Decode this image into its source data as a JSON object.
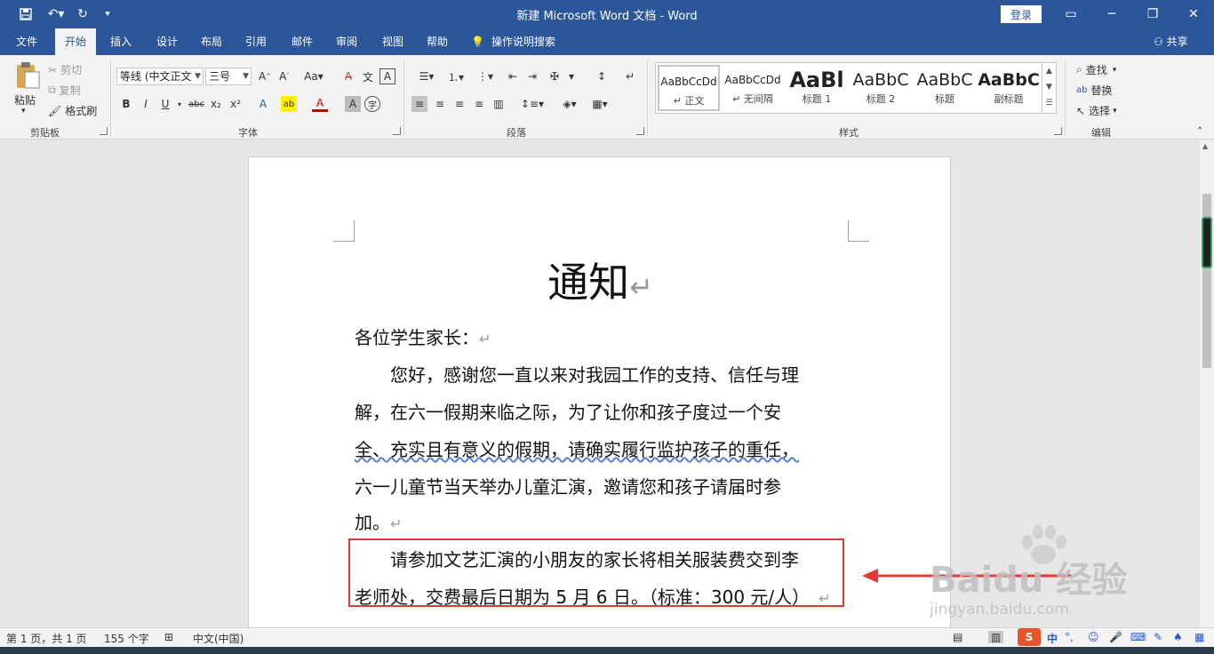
{
  "titlebar": {
    "title": "新建 Microsoft Word 文档 - Word",
    "login": "登录"
  },
  "tabs": [
    "文件",
    "开始",
    "插入",
    "设计",
    "布局",
    "引用",
    "邮件",
    "审阅",
    "视图",
    "帮助"
  ],
  "tell_me": "操作说明搜索",
  "share": "共享",
  "clipboard": {
    "paste": "粘贴",
    "cut": "剪切",
    "copy": "复制",
    "format_painter": "格式刷",
    "label": "剪贴板"
  },
  "font": {
    "family": "等线 (中文正文",
    "size": "三号",
    "label": "字体"
  },
  "paragraph": {
    "label": "段落"
  },
  "styles": {
    "label": "样式",
    "items": [
      {
        "sample": "AaBbCcDd",
        "name": "↵ 正文"
      },
      {
        "sample": "AaBbCcDd",
        "name": "↵ 无间隔"
      },
      {
        "sample": "AaBl",
        "name": "标题 1"
      },
      {
        "sample": "AaBbC",
        "name": "标题 2"
      },
      {
        "sample": "AaBbC",
        "name": "标题"
      },
      {
        "sample": "AaBbC",
        "name": "副标题"
      }
    ]
  },
  "editing": {
    "find": "查找",
    "replace": "替换",
    "select": "选择",
    "label": "编辑"
  },
  "document": {
    "title": "通知",
    "greeting": "各位学生家长：",
    "lines": [
      "　　您好，感谢您一直以来对我园工作的支持、信任与理",
      "解，在六一假期来临之际，为了让你和孩子度过一个安",
      "全、充实且有意义的假期，请确实履行监护孩子的重任，",
      "六一儿童节当天举办儿童汇演，邀请您和孩子请届时参",
      "加。"
    ],
    "highlight_lines": [
      "　　请参加文艺汇演的小朋友的家长将相关服装费交到李",
      "老师处，交费最后日期为 5 月 6 日。（标准：300 元/人）"
    ],
    "paragraph_mark": "↵"
  },
  "status": {
    "page": "第 1 页，共 1 页",
    "words": "155 个字",
    "language": "中文(中国)"
  },
  "watermark": {
    "brand": "Baidu 经验",
    "url": "jingyan.baidu.com"
  },
  "ime": {
    "lang": "中"
  }
}
